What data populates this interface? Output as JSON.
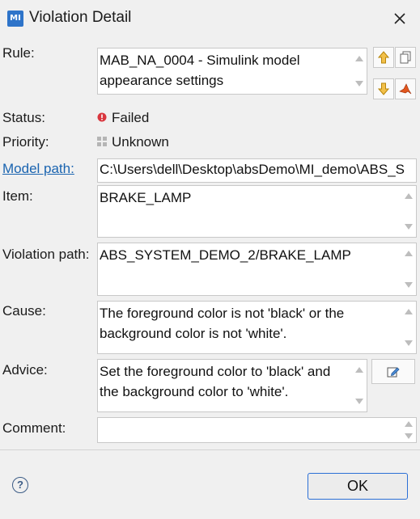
{
  "window": {
    "app_icon_text": "MI",
    "title": "Violation Detail"
  },
  "fields": {
    "rule": {
      "label": "Rule:",
      "value": "MAB_NA_0004 - Simulink model appearance settings"
    },
    "status": {
      "label": "Status:",
      "value": "Failed",
      "icon": "error-icon"
    },
    "priority": {
      "label": "Priority:",
      "value": "Unknown",
      "icon": "priority-grid-icon"
    },
    "model_path": {
      "label": "Model path:",
      "value": "C:\\Users\\dell\\Desktop\\absDemo\\MI_demo\\ABS_S"
    },
    "item": {
      "label": "Item:",
      "value": "BRAKE_LAMP"
    },
    "violation_path": {
      "label": "Violation path:",
      "value": "ABS_SYSTEM_DEMO_2/BRAKE_LAMP"
    },
    "cause": {
      "label": "Cause:",
      "value": "The foreground color is not 'black' or the background color is not 'white'."
    },
    "advice": {
      "label": "Advice:",
      "value": "Set the foreground color to 'black' and the background color to 'white'."
    },
    "comment": {
      "label": "Comment:",
      "value": ""
    }
  },
  "buttons": {
    "ok": "OK",
    "help": "?"
  },
  "colors": {
    "accent": "#2b6fd6",
    "link": "#1a64b0",
    "status_failed": "#d9363e",
    "app_icon": "#2e74c9"
  }
}
